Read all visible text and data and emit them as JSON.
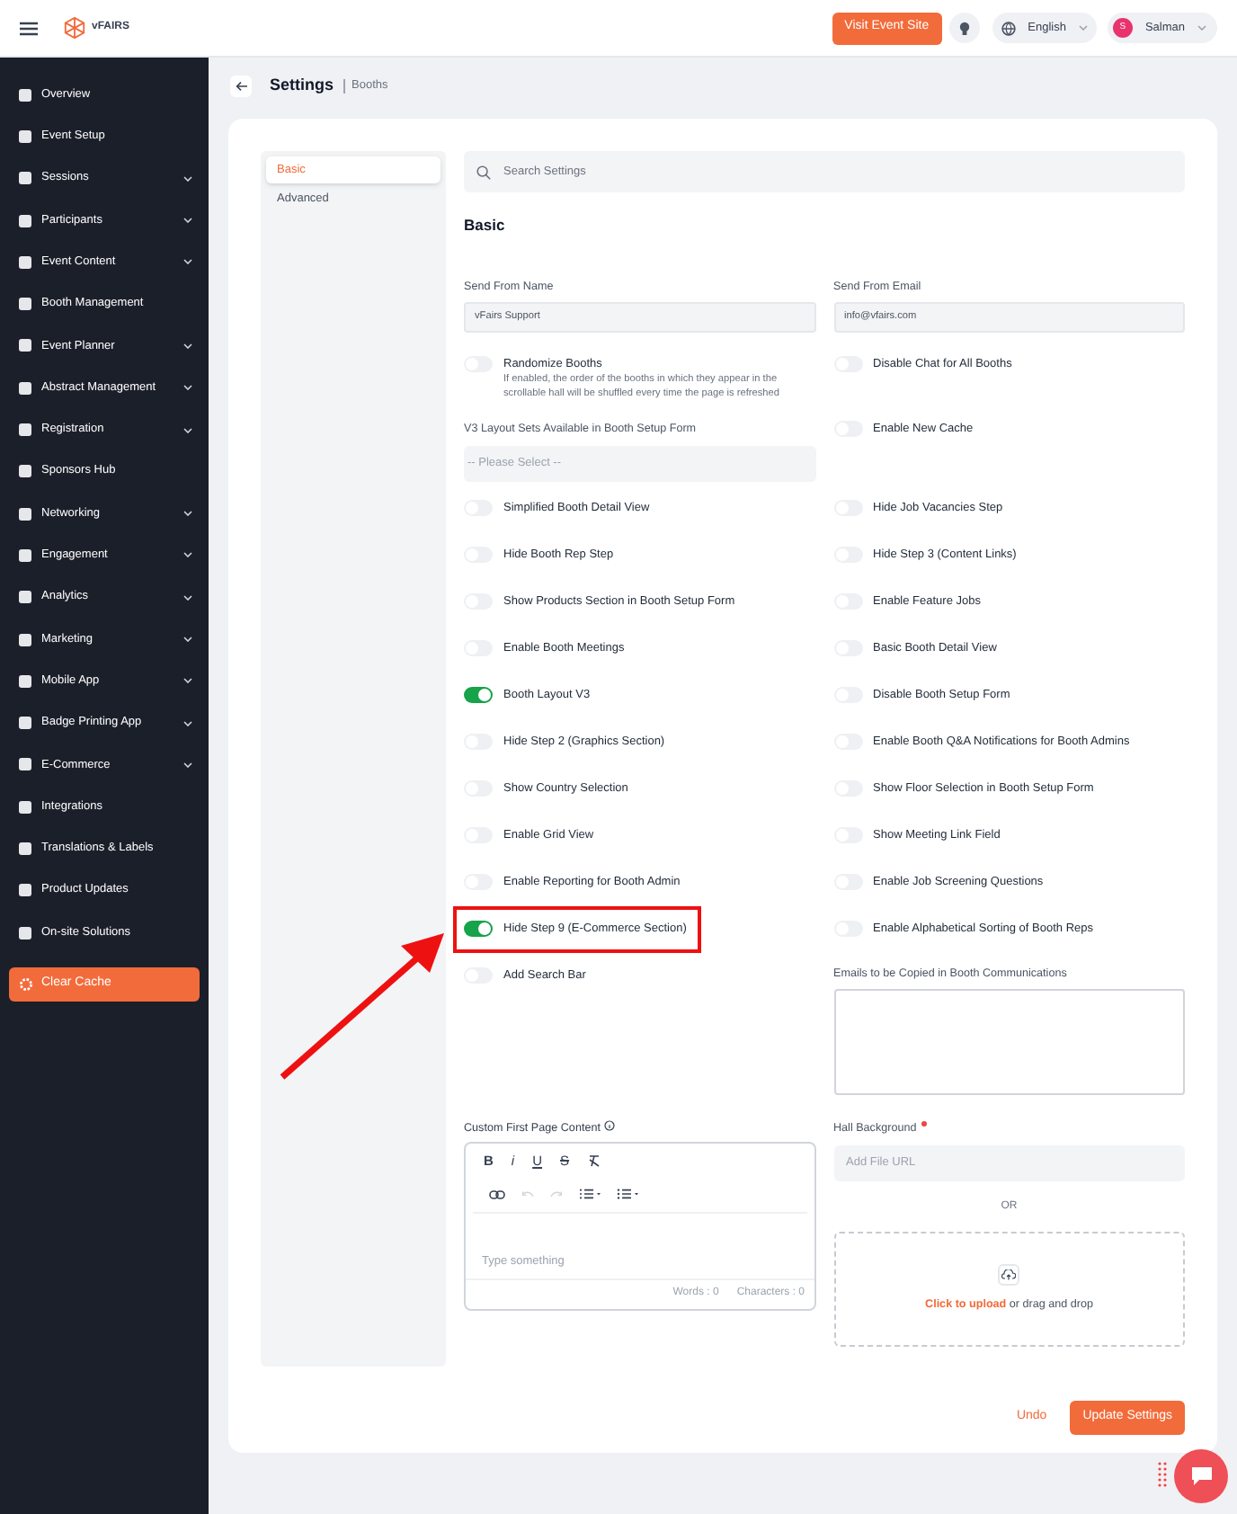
{
  "topbar": {
    "logo": "vFAIRS",
    "visit_button": "Visit Event Site",
    "language": "English",
    "user": {
      "initial": "S",
      "name": "Salman"
    }
  },
  "sidebar": {
    "items": [
      {
        "label": "Overview",
        "has_submenu": false
      },
      {
        "label": "Event Setup",
        "has_submenu": false
      },
      {
        "label": "Sessions",
        "has_submenu": true
      },
      {
        "label": "Participants",
        "has_submenu": true
      },
      {
        "label": "Event Content",
        "has_submenu": true
      },
      {
        "label": "Booth Management",
        "has_submenu": false
      },
      {
        "label": "Event Planner",
        "has_submenu": true
      },
      {
        "label": "Abstract Management",
        "has_submenu": true
      },
      {
        "label": "Registration",
        "has_submenu": true
      },
      {
        "label": "Sponsors Hub",
        "has_submenu": false
      },
      {
        "label": "Networking",
        "has_submenu": true
      },
      {
        "label": "Engagement",
        "has_submenu": true
      },
      {
        "label": "Analytics",
        "has_submenu": true
      },
      {
        "label": "Marketing",
        "has_submenu": true
      },
      {
        "label": "Mobile App",
        "has_submenu": true
      },
      {
        "label": "Badge Printing App",
        "has_submenu": true
      },
      {
        "label": "E-Commerce",
        "has_submenu": true
      },
      {
        "label": "Integrations",
        "has_submenu": false
      },
      {
        "label": "Translations & Labels",
        "has_submenu": false
      },
      {
        "label": "Product Updates",
        "has_submenu": false
      },
      {
        "label": "On-site Solutions",
        "has_submenu": false
      }
    ],
    "clear_cache": "Clear Cache"
  },
  "header": {
    "title": "Settings",
    "breadcrumb": "Booths"
  },
  "tabs": [
    {
      "label": "Basic",
      "selected": true
    },
    {
      "label": "Advanced",
      "selected": false
    }
  ],
  "search": {
    "placeholder": "Search Settings"
  },
  "section_title": "Basic",
  "rows": [
    {
      "cells": [
        {
          "kind": "field",
          "label": "Send From Name",
          "value": "vFairs Support"
        },
        {
          "kind": "field",
          "label": "Send From Email",
          "value": "info@vfairs.com"
        }
      ]
    },
    {
      "cells": [
        {
          "kind": "toggle",
          "label": "Randomize Booths",
          "on": false,
          "description": "If enabled, the order of the booths in which they appear in the scrollable hall will be shuffled every time the page is refreshed"
        },
        {
          "kind": "toggle",
          "label": "Disable Chat for All Booths",
          "on": false
        }
      ]
    },
    {
      "cells": [
        {
          "kind": "select",
          "label": "V3 Layout Sets Available in Booth Setup Form",
          "placeholder": "-- Please Select --"
        },
        {
          "kind": "toggle",
          "label": "Enable New Cache",
          "on": false
        }
      ]
    },
    {
      "cells": [
        {
          "kind": "toggle",
          "label": "Simplified Booth Detail View",
          "on": false
        },
        {
          "kind": "toggle",
          "label": "Hide Job Vacancies Step",
          "on": false
        }
      ]
    },
    {
      "cells": [
        {
          "kind": "toggle",
          "label": "Hide Booth Rep Step",
          "on": false
        },
        {
          "kind": "toggle",
          "label": "Hide Step 3 (Content Links)",
          "on": false
        }
      ]
    },
    {
      "cells": [
        {
          "kind": "toggle",
          "label": "Show Products Section in Booth Setup Form",
          "on": false
        },
        {
          "kind": "toggle",
          "label": "Enable Feature Jobs",
          "on": false
        }
      ]
    },
    {
      "cells": [
        {
          "kind": "toggle",
          "label": "Enable Booth Meetings",
          "on": false
        },
        {
          "kind": "toggle",
          "label": "Basic Booth Detail View",
          "on": false
        }
      ]
    },
    {
      "cells": [
        {
          "kind": "toggle",
          "label": "Booth Layout V3",
          "on": true
        },
        {
          "kind": "toggle",
          "label": "Disable Booth Setup Form",
          "on": false
        }
      ]
    },
    {
      "cells": [
        {
          "kind": "toggle",
          "label": "Hide Step 2 (Graphics Section)",
          "on": false
        },
        {
          "kind": "toggle",
          "label": "Enable Booth Q&A Notifications for Booth Admins",
          "on": false
        }
      ]
    },
    {
      "cells": [
        {
          "kind": "toggle",
          "label": "Show Country Selection",
          "on": false
        },
        {
          "kind": "toggle",
          "label": "Show Floor Selection in Booth Setup Form",
          "on": false
        }
      ]
    },
    {
      "cells": [
        {
          "kind": "toggle",
          "label": "Enable Grid View",
          "on": false
        },
        {
          "kind": "toggle",
          "label": "Show Meeting Link Field",
          "on": false
        }
      ]
    },
    {
      "cells": [
        {
          "kind": "toggle",
          "label": "Enable Reporting for Booth Admin",
          "on": false
        },
        {
          "kind": "toggle",
          "label": "Enable Job Screening Questions",
          "on": false
        }
      ]
    },
    {
      "cells": [
        {
          "kind": "toggle",
          "label": "Hide Step 9 (E-Commerce Section)",
          "on": true,
          "highlighted": true
        },
        {
          "kind": "toggle",
          "label": "Enable Alphabetical Sorting of Booth Reps",
          "on": false
        }
      ]
    },
    {
      "cells": [
        {
          "kind": "toggle",
          "label": "Add Search Bar",
          "on": false
        },
        {
          "kind": "textarea",
          "label": "Emails to be Copied in Booth Communications"
        }
      ]
    },
    {
      "cells": [
        {
          "kind": "editor",
          "label": "Custom First Page Content",
          "format_buttons": [
            {
              "kind": "bold",
              "label": "B"
            },
            {
              "kind": "italic",
              "label": "i"
            },
            {
              "kind": "underline",
              "label": "U"
            },
            {
              "kind": "strike",
              "label": "S"
            }
          ],
          "placeholder": "Type something",
          "words": "Words : 0",
          "characters": "Characters : 0"
        },
        {
          "kind": "upload",
          "label": "Hall Background",
          "required": true,
          "placeholder": "Add File URL",
          "or": "OR",
          "link": "Click to upload",
          "rest": "or drag and drop"
        }
      ]
    }
  ],
  "actions": {
    "undo": "Undo",
    "submit": "Update Settings"
  }
}
